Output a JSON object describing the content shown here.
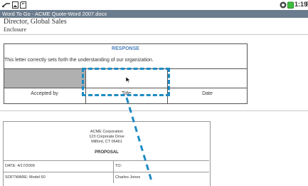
{
  "status_bar": {
    "time": "1:19",
    "time_suffix": "P",
    "left_icons": [
      "usb-icon",
      "image-icon",
      "sd-card-icon"
    ],
    "right_icons": [
      "wifi-icon",
      "battery-icon"
    ]
  },
  "window": {
    "title": "Word To Go - ACME Quote-Word 2007.docx"
  },
  "document": {
    "signature_title": "Director, Global Sales",
    "enclosure": "Enclosure",
    "response_table": {
      "header": "RESPONSE",
      "sentence": "This letter correctly sets forth the understanding of our organization.",
      "labels": [
        "Accepted by",
        "Title",
        "Date"
      ]
    },
    "proposal": {
      "company": "ACME Corporation",
      "address1": "123 Corporate Drive",
      "address2": "Milford, CT  06461",
      "heading": "PROPOSAL",
      "date": "DATE: 4/17/2009",
      "to": "TO:",
      "software": "SOFTWARE: Model 60",
      "to_name": "Charles Jones"
    }
  },
  "colors": {
    "title_bar": "#6b7c8e",
    "response_header": "#4f81bd",
    "callout": "#1e8bc3",
    "shaded_cell": "#b0b0b0"
  }
}
